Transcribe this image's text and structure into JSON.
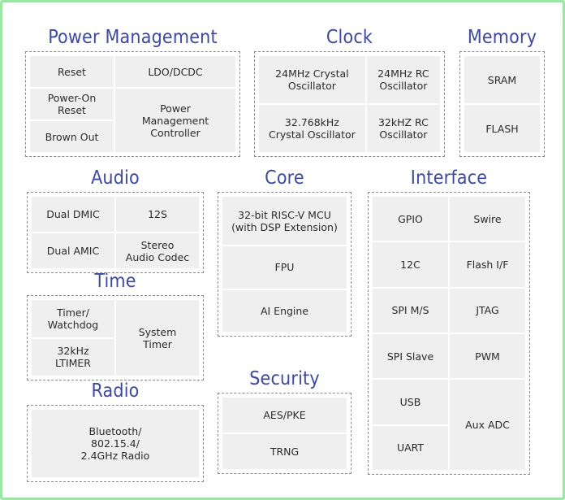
{
  "diagram": {
    "border_color": "#93eaa0",
    "title_color": "#3a47b0",
    "cell_color": "#efefef",
    "dash_color": "#8c8c8c"
  },
  "sections": {
    "power": {
      "title": "Power Management",
      "cells": {
        "reset": "Reset",
        "ldo_dcdc": "LDO/DCDC",
        "power_on_reset": "Power-On\nReset",
        "pmc": "Power\nManagement\nController",
        "brown_out": "Brown Out"
      }
    },
    "clock": {
      "title": "Clock",
      "cells": {
        "xtal_24m": "24MHz Crystal\nOscillator",
        "rc_24m": "24MHz RC\nOscillator",
        "xtal_32k": "32.768kHz\nCrystal Oscillator",
        "rc_32k": "32kHZ RC\nOscillator"
      }
    },
    "memory": {
      "title": "Memory",
      "cells": {
        "sram": "SRAM",
        "flash": "FLASH"
      }
    },
    "audio": {
      "title": "Audio",
      "cells": {
        "dual_dmic": "Dual DMIC",
        "i2s": "12S",
        "dual_amic": "Dual AMIC",
        "codec": "Stereo\nAudio Codec"
      }
    },
    "time": {
      "title": "Time",
      "cells": {
        "timer_watchdog": "Timer/\nWatchdog",
        "system_timer": "System\nTimer",
        "ltimer": "32kHz\nLTIMER"
      }
    },
    "radio": {
      "title": "Radio",
      "cells": {
        "radio": "Bluetooth/\n802.15.4/\n2.4GHz Radio"
      }
    },
    "core": {
      "title": "Core",
      "cells": {
        "mcu": "32-bit RISC-V MCU\n(with DSP Extension)",
        "fpu": "FPU",
        "ai_engine": "AI Engine"
      }
    },
    "security": {
      "title": "Security",
      "cells": {
        "aes_pke": "AES/PKE",
        "trng": "TRNG"
      }
    },
    "interface": {
      "title": "Interface",
      "cells": {
        "gpio": "GPIO",
        "swire": "Swire",
        "i2c": "12C",
        "flash_if": "Flash I/F",
        "spi_ms": "SPI M/S",
        "jtag": "JTAG",
        "spi_slave": "SPI Slave",
        "pwm": "PWM",
        "usb": "USB",
        "aux_adc": "Aux ADC",
        "uart": "UART"
      }
    }
  }
}
